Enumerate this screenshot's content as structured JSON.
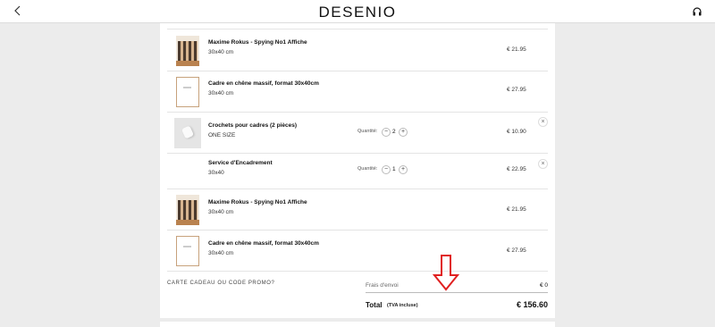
{
  "header": {
    "logo": "DESENIO",
    "back_icon": "chevron-left-icon",
    "support_icon": "headphones-icon"
  },
  "cart": {
    "items": [
      {
        "name": "Maxime Rokus - Spying No1 Affiche",
        "variant": "30x40 cm",
        "price": "€ 21.95",
        "thumb": "poster-thumbnail"
      },
      {
        "name": "Cadre en chêne massif, format 30x40cm",
        "variant": "30x40 cm",
        "price": "€ 27.95",
        "thumb": "oak-frame-thumbnail"
      },
      {
        "name": "Crochets pour cadres (2 pièces)",
        "variant": "ONE SIZE",
        "price": "€ 10.90",
        "thumb": "frame-hooks-thumbnail",
        "quantity_label": "Quantité:",
        "quantity": "2",
        "minus": "−",
        "plus": "+",
        "remove": "×"
      },
      {
        "name": "Service d'Encadrement",
        "variant": "30x40",
        "price": "€ 22.95",
        "quantity_label": "Quantité:",
        "quantity": "1",
        "minus": "−",
        "plus": "+",
        "remove": "×"
      },
      {
        "name": "Maxime Rokus - Spying No1 Affiche",
        "variant": "30x40 cm",
        "price": "€ 21.95",
        "thumb": "poster-thumbnail"
      },
      {
        "name": "Cadre en chêne massif, format 30x40cm",
        "variant": "30x40 cm",
        "price": "€ 27.95",
        "thumb": "oak-frame-thumbnail"
      }
    ]
  },
  "summary": {
    "promo_link": "CARTE CADEAU OU CODE PROMO?",
    "shipping_label": "Frais d'envoi",
    "shipping_value": "€ 0",
    "total_label": "Total",
    "total_note": "(TVA incluse)",
    "total_value": "€ 156.60"
  },
  "annotation": {
    "icon": "red-down-arrow-icon",
    "color": "#e02020"
  },
  "colors": {
    "background": "#ececec",
    "panel": "#ffffff",
    "frame_oak": "#c7a27c"
  }
}
